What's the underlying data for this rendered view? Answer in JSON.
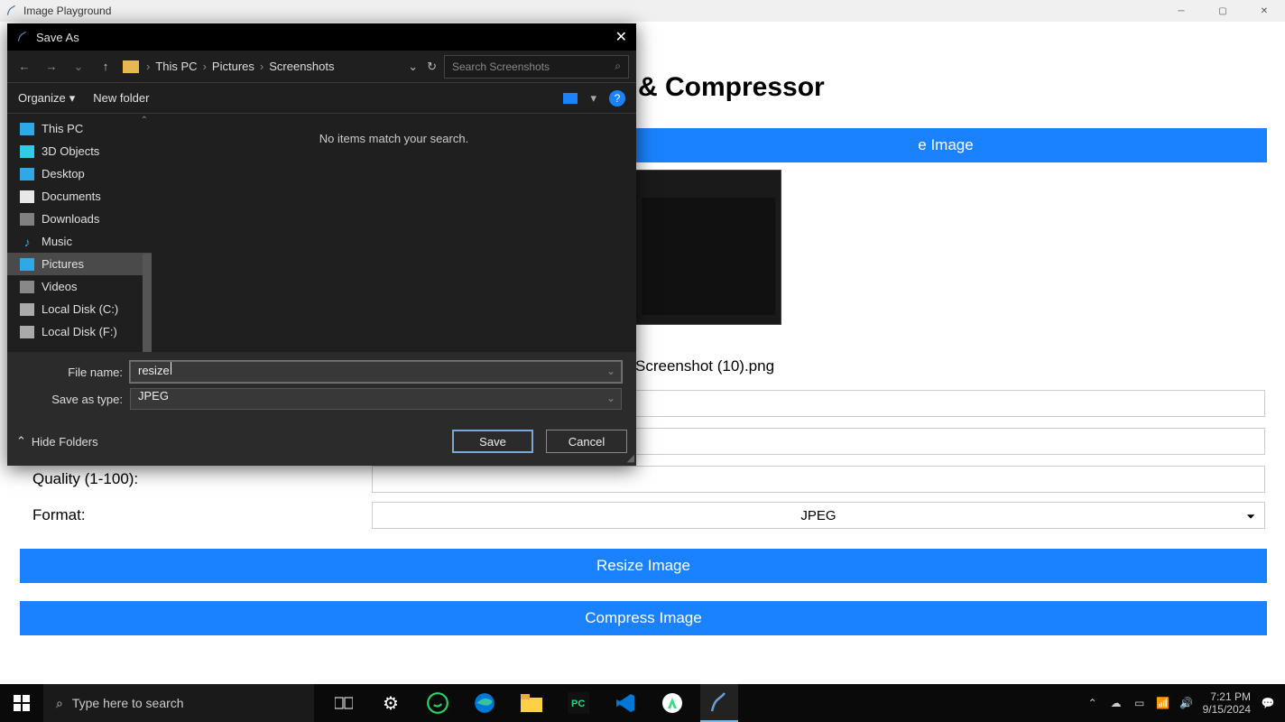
{
  "app": {
    "title": "Image Playground",
    "heading_fragment": "& Compressor",
    "browse_button_fragment": "e Image",
    "filename": "Screenshot (10).png",
    "quality_label": "Quality (1-100):",
    "format_label": "Format:",
    "format_value": "JPEG",
    "resize_button": "Resize Image",
    "compress_button": "Compress Image"
  },
  "dialog": {
    "title": "Save As",
    "breadcrumb": {
      "p1": "This PC",
      "p2": "Pictures",
      "p3": "Screenshots"
    },
    "search_placeholder": "Search Screenshots",
    "organize": "Organize",
    "new_folder": "New folder",
    "empty_message": "No items match your search.",
    "sidebar": {
      "this_pc": "This PC",
      "objects_3d": "3D Objects",
      "desktop": "Desktop",
      "documents": "Documents",
      "downloads": "Downloads",
      "music": "Music",
      "pictures": "Pictures",
      "videos": "Videos",
      "local_c": "Local Disk (C:)",
      "local_f": "Local Disk (F:)"
    },
    "file_name_label": "File name:",
    "file_name_value": "resize",
    "save_as_type_label": "Save as type:",
    "save_as_type_value": "JPEG",
    "hide_folders": "Hide Folders",
    "save": "Save",
    "cancel": "Cancel"
  },
  "taskbar": {
    "search_placeholder": "Type here to search",
    "time": "7:21 PM",
    "date": "9/15/2024"
  }
}
